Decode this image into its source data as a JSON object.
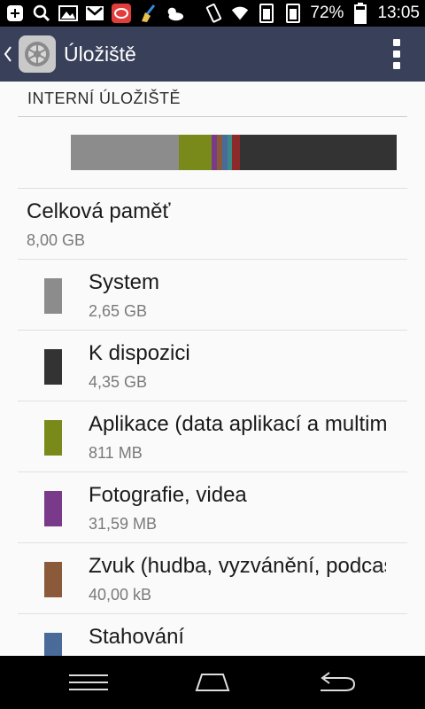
{
  "status_bar": {
    "battery_percent": "72%",
    "time": "13:05",
    "icons": [
      "plus-icon",
      "search-icon",
      "image-icon",
      "gmail-icon",
      "app-icon",
      "broom-icon",
      "weather-icon",
      "vibrate-icon",
      "wifi-icon",
      "sim1-icon",
      "sim2-icon",
      "battery-icon"
    ]
  },
  "action_bar": {
    "title": "Úložiště",
    "icons": [
      "back-chevron-icon",
      "settings-gear-icon",
      "overflow-menu-icon"
    ]
  },
  "section": {
    "header": "INTERNÍ ÚLOŽIŠTĚ"
  },
  "usage_bar": {
    "segments": [
      {
        "name": "System",
        "fraction": 0.331,
        "color": "#8c8c8c"
      },
      {
        "name": "Aplikace",
        "fraction": 0.101,
        "color": "#7a8a1a"
      },
      {
        "name": "Fotografie",
        "fraction": 0.016,
        "color": "#7a3a8a"
      },
      {
        "name": "Zvuk",
        "fraction": 0.016,
        "color": "#8a5a3a"
      },
      {
        "name": "Stahování",
        "fraction": 0.016,
        "color": "#4a6a9a"
      },
      {
        "name": "other-teal",
        "fraction": 0.016,
        "color": "#3a8a8a"
      },
      {
        "name": "other-red",
        "fraction": 0.022,
        "color": "#8a2a2a"
      },
      {
        "name": "K dispozici",
        "fraction": 0.482,
        "color": "#333333"
      }
    ]
  },
  "total": {
    "title": "Celková paměť",
    "value": "8,00 GB"
  },
  "items": [
    {
      "title": "System",
      "value": "2,65 GB",
      "color": "#8c8c8c"
    },
    {
      "title": "K dispozici",
      "value": "4,35 GB",
      "color": "#333333"
    },
    {
      "title": "Aplikace (data aplikací a multimédií)",
      "value": "811 MB",
      "color": "#7a8a1a"
    },
    {
      "title": "Fotografie, videa",
      "value": "31,59 MB",
      "color": "#7a3a8a"
    },
    {
      "title": "Zvuk (hudba, vyzvánění, podcasty)",
      "value": "40,00 kB",
      "color": "#8a5a3a"
    },
    {
      "title": "Stahování",
      "value": "",
      "color": "#4a6a9a"
    }
  ],
  "nav_bar": {
    "icons": [
      "menu-icon",
      "home-icon",
      "back-icon"
    ]
  }
}
